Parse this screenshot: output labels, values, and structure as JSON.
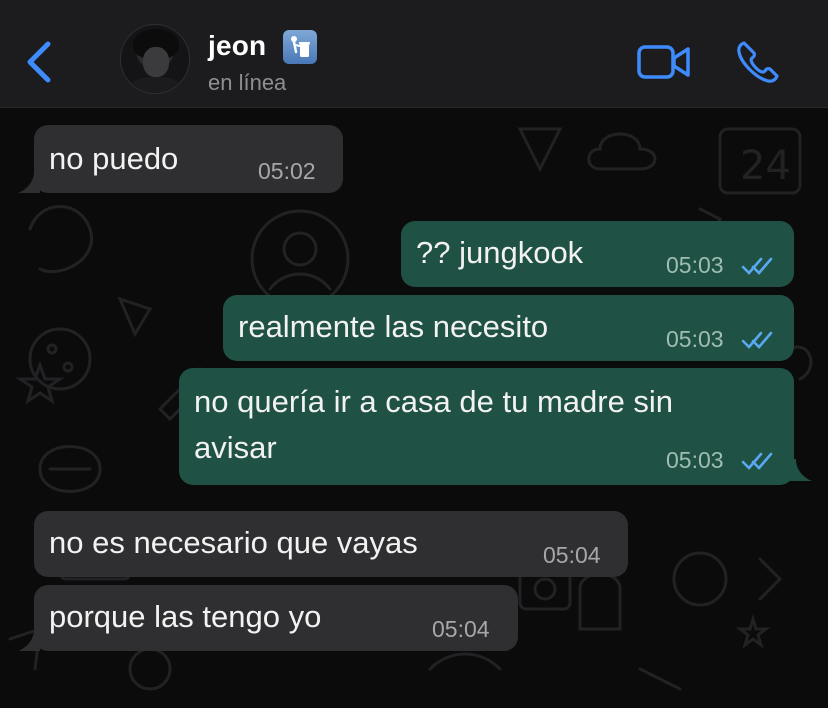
{
  "header": {
    "back_label": "",
    "contact_name": "jeon",
    "status": "en línea",
    "name_emoji": "trash-bin-emoji"
  },
  "messages": [
    {
      "direction": "incoming",
      "text": "no puedo",
      "time": "05:02"
    },
    {
      "direction": "outgoing",
      "text": "?? jungkook",
      "time": "05:03",
      "read": true
    },
    {
      "direction": "outgoing",
      "text": "realmente las necesito",
      "time": "05:03",
      "read": true
    },
    {
      "direction": "outgoing",
      "text_line1": "no quería ir a casa de tu madre sin",
      "text_line2": "avisar",
      "time": "05:03",
      "read": true
    },
    {
      "direction": "incoming",
      "text": "no es necesario que vayas",
      "time": "05:04"
    },
    {
      "direction": "incoming",
      "text": "porque las tengo yo",
      "time": "05:04"
    }
  ],
  "colors": {
    "accent": "#3d8bfd",
    "incoming_bubble": "#2f2f31",
    "outgoing_bubble": "#1f5144",
    "read_ticks": "#5aa9f0"
  }
}
